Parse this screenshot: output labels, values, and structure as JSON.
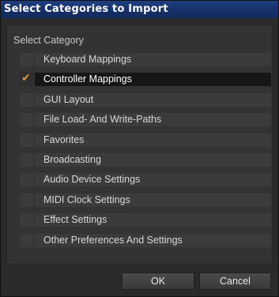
{
  "window": {
    "title": "Select Categories to Import"
  },
  "section_label": "Select Category",
  "categories": [
    {
      "label": "Keyboard Mappings",
      "checked": false
    },
    {
      "label": "Controller Mappings",
      "checked": true
    },
    {
      "label": "GUI Layout",
      "checked": false
    },
    {
      "label": "File Load- And Write-Paths",
      "checked": false
    },
    {
      "label": "Favorites",
      "checked": false
    },
    {
      "label": "Broadcasting",
      "checked": false
    },
    {
      "label": "Audio Device Settings",
      "checked": false
    },
    {
      "label": "MIDI Clock Settings",
      "checked": false
    },
    {
      "label": "Effect Settings",
      "checked": false
    },
    {
      "label": "Other Preferences And Settings",
      "checked": false
    }
  ],
  "check_glyph": "✔",
  "buttons": {
    "ok_label": "OK",
    "cancel_label": "Cancel"
  },
  "colors": {
    "title_bar": "#1a3673",
    "check_mark": "#e59a3a",
    "selected_row": "#161616"
  }
}
